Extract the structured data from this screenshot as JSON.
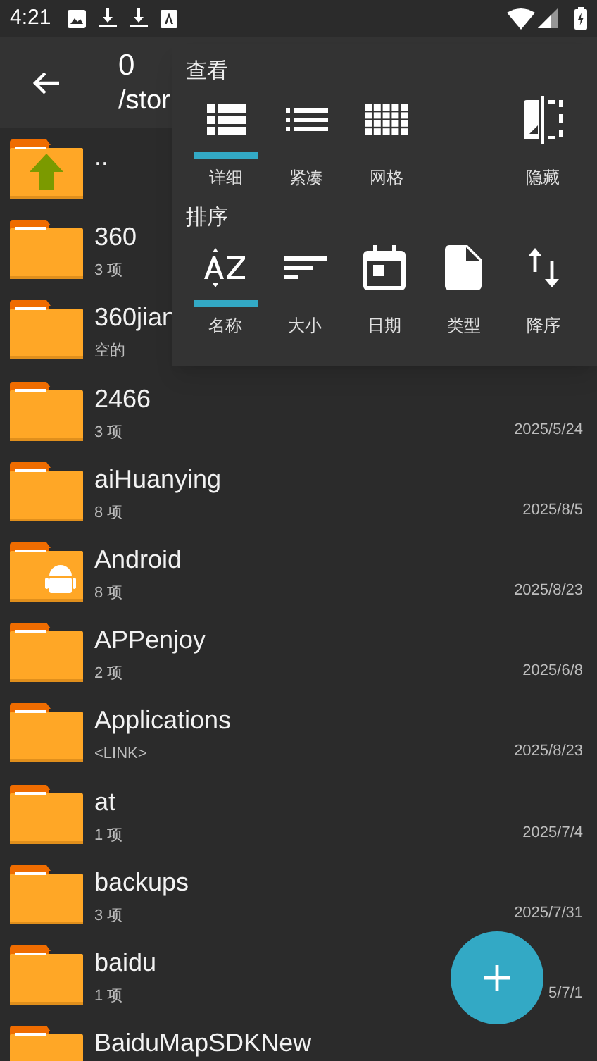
{
  "status_bar": {
    "time": "4:21"
  },
  "header": {
    "title": "0",
    "path": "/stor"
  },
  "files": [
    {
      "kind": "up",
      "name": ".."
    },
    {
      "kind": "folder",
      "name": "360",
      "info": "3 项"
    },
    {
      "kind": "folder",
      "name": "360jian",
      "info": "空的"
    },
    {
      "kind": "folder",
      "name": "2466",
      "info": "3 项",
      "date": "2025/5/24"
    },
    {
      "kind": "folder",
      "name": "aiHuanying",
      "info": "8 项",
      "date": "2025/8/5"
    },
    {
      "kind": "android",
      "name": "Android",
      "info": "8 项",
      "date": "2025/8/23"
    },
    {
      "kind": "folder",
      "name": "APPenjoy",
      "info": "2 项",
      "date": "2025/6/8"
    },
    {
      "kind": "folder",
      "name": "Applications",
      "info": "<LINK>",
      "date": "2025/8/23"
    },
    {
      "kind": "folder",
      "name": "at",
      "info": "1 项",
      "date": "2025/7/4"
    },
    {
      "kind": "folder",
      "name": "backups",
      "info": "3 项",
      "date": "2025/7/31"
    },
    {
      "kind": "folder",
      "name": "baidu",
      "info": "1 项",
      "date": "5/7/1"
    },
    {
      "kind": "folder",
      "name": "BaiduMapSDKNew"
    }
  ],
  "menu": {
    "view_title": "查看",
    "view_options": [
      {
        "kind": "detail",
        "label": "详细",
        "selected": true
      },
      {
        "kind": "compact",
        "label": "紧凑",
        "selected": false
      },
      {
        "kind": "grid",
        "label": "网格",
        "selected": false
      }
    ],
    "hide": {
      "label": "隐藏"
    },
    "sort_title": "排序",
    "sort_options": [
      {
        "kind": "name",
        "label": "名称",
        "selected": true
      },
      {
        "kind": "size",
        "label": "大小",
        "selected": false
      },
      {
        "kind": "date",
        "label": "日期",
        "selected": false
      },
      {
        "kind": "type",
        "label": "类型",
        "selected": false
      },
      {
        "kind": "order",
        "label": "降序",
        "selected": false
      }
    ]
  }
}
